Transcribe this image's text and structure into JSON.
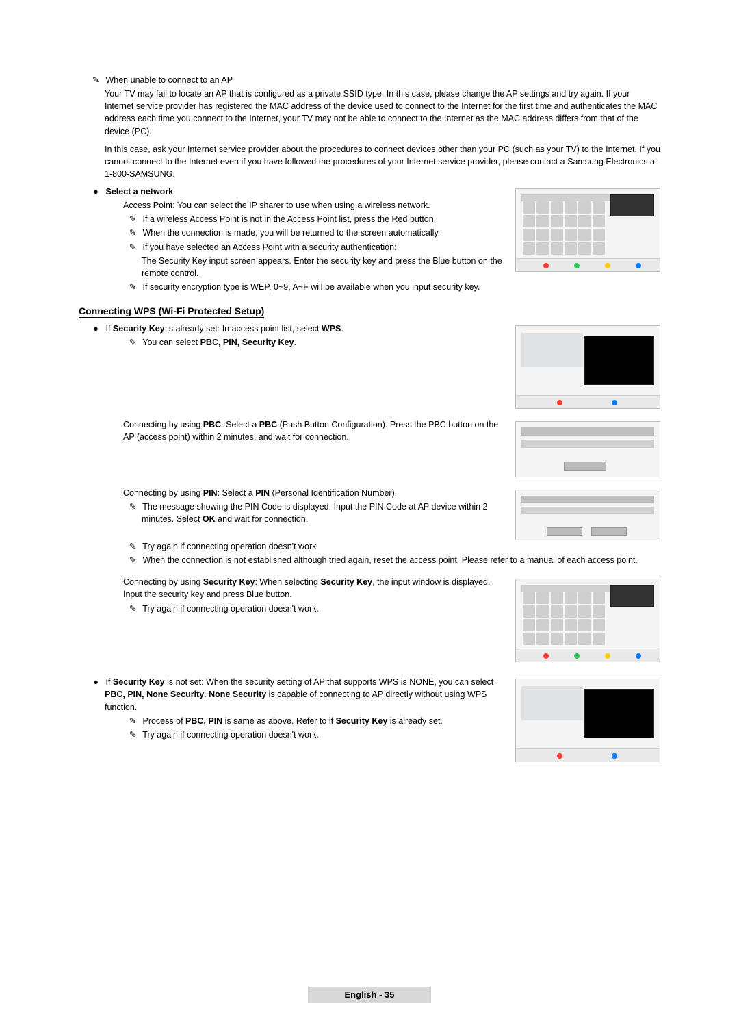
{
  "note_glyph": "✎",
  "bullet_glyph": "●",
  "section1": {
    "title_line": "When unable to connect to an AP",
    "para1": "Your TV may fail to locate an AP that is configured as a private SSID type. In this case, please change the AP settings and try again. If your Internet service provider has registered the MAC address of the device used to connect to the Internet for the first time and authenticates the MAC address each time you connect to the Internet, your TV may not be able to connect to the Internet as the MAC address differs from that of the device (PC).",
    "para2": "In this case, ask your Internet service provider about the procedures to connect devices other than your PC (such as your TV) to the Internet. If you cannot connect to the Internet even if you have followed the procedures of your Internet service provider, please contact a Samsung Electronics at 1-800-SAMSUNG.",
    "select_network_label": "Select a network",
    "ap_line": "Access Point: You can select the IP sharer to use when using a wireless network.",
    "n1": "If a wireless Access Point is not in the Access Point list, press the Red button.",
    "n2": "When the connection is made, you will be returned to the screen automatically.",
    "n3": "If you have selected an Access Point with a security authentication:",
    "n3b": "The Security Key input screen appears. Enter the security key and press the Blue button on the remote control.",
    "n4": "If security encryption type is WEP, 0~9, A~F will be available when you input security key."
  },
  "heading_wps": "Connecting WPS (Wi-Fi Protected Setup)",
  "wps": {
    "line1_pre": "If ",
    "line1_bold1": "Security Key",
    "line1_mid": " is already set: In access point list, select ",
    "line1_bold2": "WPS",
    "line1_post": ".",
    "note1_pre": "You can select ",
    "note1_bold": "PBC, PIN, Security Key",
    "note1_post": ".",
    "pbc_pre": "Connecting by using ",
    "pbc_b1": "PBC",
    "pbc_mid": ": Select a ",
    "pbc_b2": "PBC",
    "pbc_post": " (Push Button Configuration). Press the PBC button on the AP (access point) within 2 minutes, and wait for connection.",
    "pin_pre": "Connecting by using ",
    "pin_b1": "PIN",
    "pin_mid": ": Select a ",
    "pin_b2": "PIN",
    "pin_post": " (Personal Identification Number).",
    "pin_n1_a": "The message showing the PIN Code is displayed. Input the PIN Code at AP device within 2 minutes. Select ",
    "pin_n1_ok": "OK",
    "pin_n1_b": " and wait for connection.",
    "pin_n2": "Try again if connecting operation doesn't work",
    "pin_n3": "When the connection is not established although tried again, reset the access point. Please refer to a manual of each access point.",
    "sk_pre": "Connecting by using ",
    "sk_b1": "Security Key",
    "sk_mid": ": When selecting ",
    "sk_b2": "Security Key",
    "sk_post": ", the input window is displayed. Input the security key and press Blue button.",
    "sk_n1": "Try again if connecting operation doesn't work.",
    "notset_pre": "If ",
    "notset_b1": "Security Key",
    "notset_mid": " is not set: When the security setting of AP that supports WPS is NONE, you can select ",
    "notset_b2": "PBC, PIN, None Security",
    "notset_mid2": ". ",
    "notset_b3": "None Security",
    "notset_post": " is capable of connecting to AP directly without using WPS function.",
    "notset_n1_a": "Process of ",
    "notset_n1_b": "PBC, PIN",
    "notset_n1_c": " is same as above. Refer to if ",
    "notset_n1_d": "Security Key",
    "notset_n1_e": " is already set.",
    "notset_n2": "Try again if connecting operation doesn't work."
  },
  "footer": "English - 35"
}
